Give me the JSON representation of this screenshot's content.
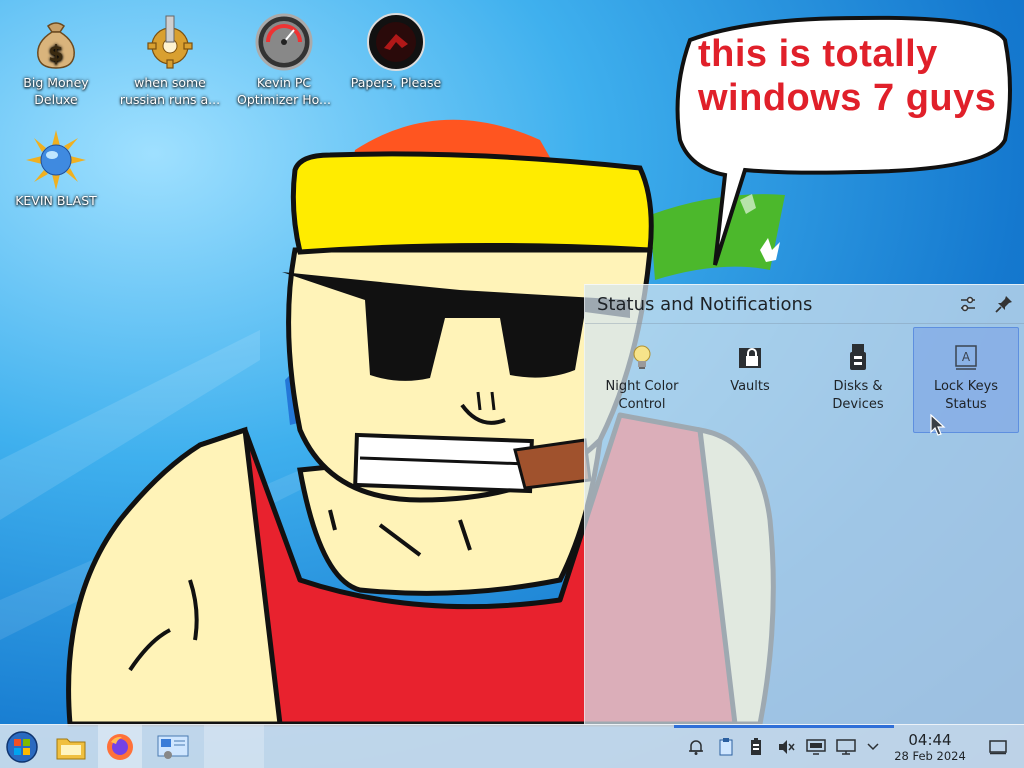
{
  "desktop": {
    "icons": [
      {
        "label": "Big Money Deluxe",
        "icon": "money-bag-icon"
      },
      {
        "label": "when some russian runs a...",
        "icon": "cog-icon"
      },
      {
        "label": "Kevin PC Optimizer Ho...",
        "icon": "speedometer-icon"
      },
      {
        "label": "Papers, Please",
        "icon": "papers-please-icon"
      },
      {
        "label": "KEVIN BLAST",
        "icon": "sun-globe-icon"
      }
    ],
    "speech_bubble": {
      "line1": "this is totally",
      "line2": "windows 7 guys"
    },
    "colors": {
      "speech_text": "#e0202a",
      "tank_top": "#e8222e",
      "headband": "#ffec00",
      "skin": "#fff3b8"
    }
  },
  "panel": {
    "title": "Status and Notifications",
    "tiles": [
      {
        "label": "Night Color Control",
        "icon": "lightbulb-icon"
      },
      {
        "label": "Vaults",
        "icon": "vault-lock-icon"
      },
      {
        "label": "Disks & Devices",
        "icon": "usb-drive-icon"
      },
      {
        "label": "Lock Keys Status",
        "icon": "keyboard-key-icon",
        "active": true
      }
    ]
  },
  "taskbar": {
    "items": [
      "start-menu-icon",
      "file-manager-icon",
      "firefox-icon",
      "system-settings-icon"
    ],
    "tray": [
      "notifications-bell-icon",
      "clipboard-icon",
      "battery-icon",
      "volume-muted-icon",
      "display-icon",
      "network-icon",
      "expand-chevron-icon"
    ],
    "clock": {
      "time": "04:44",
      "date": "28 Feb 2024"
    },
    "accent_color": "#2f6fd8"
  }
}
